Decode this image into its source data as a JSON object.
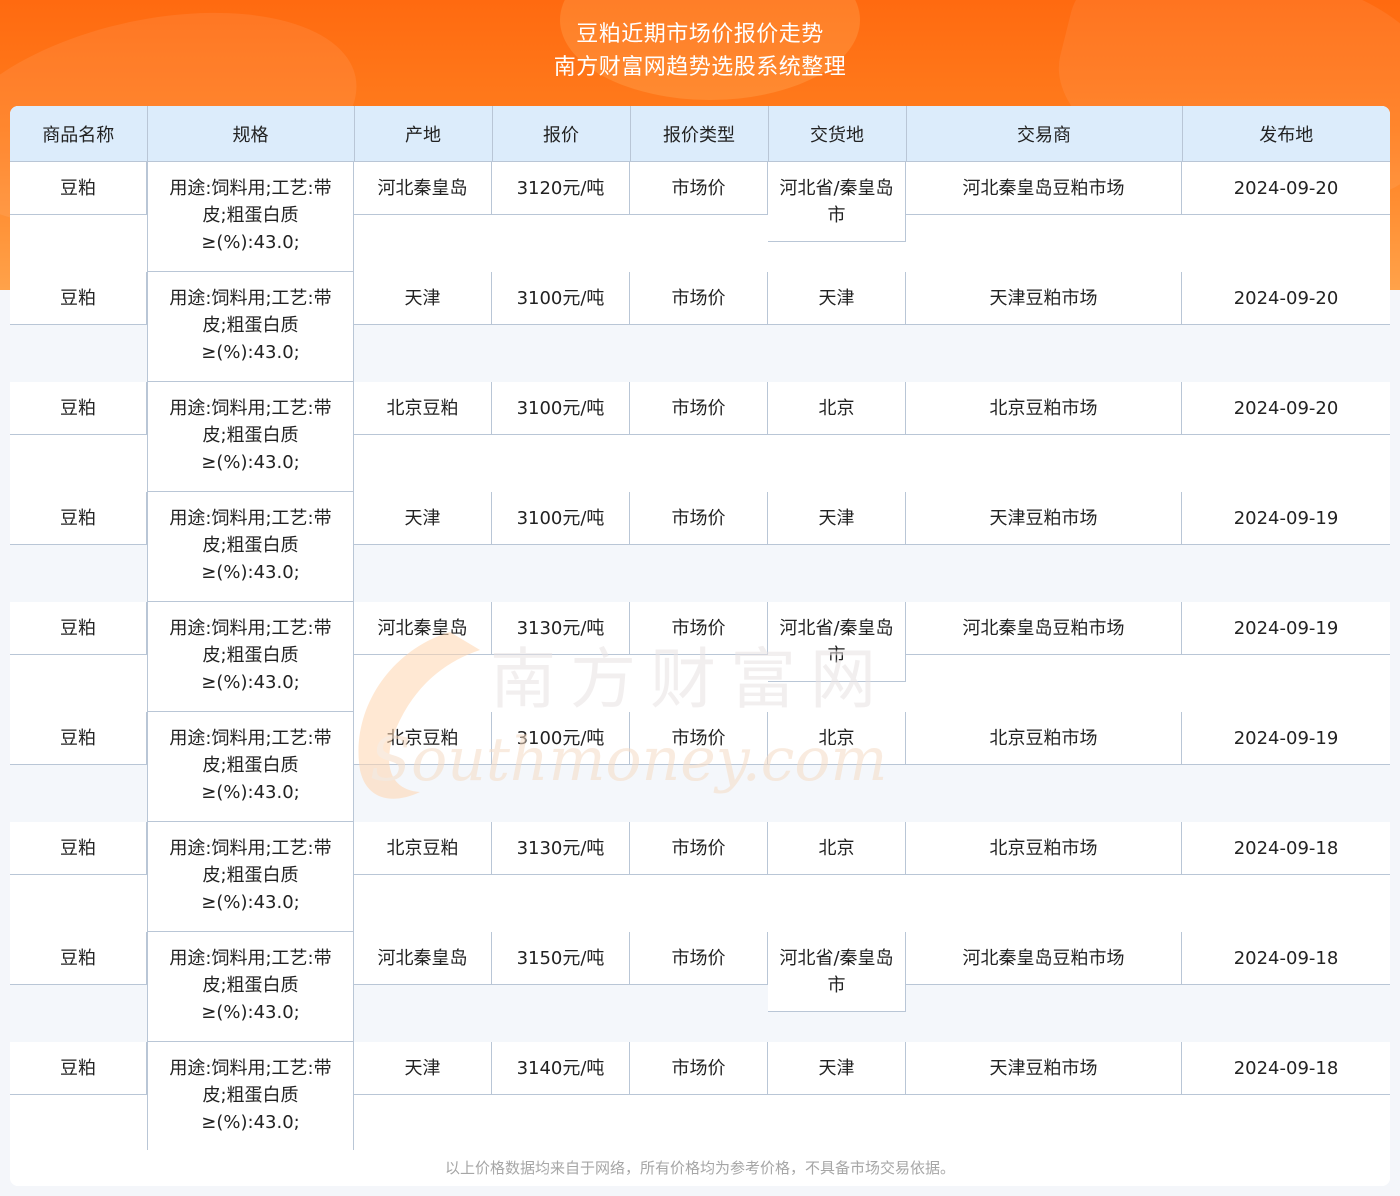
{
  "header": {
    "title": "豆粕近期市场价报价走势",
    "subtitle": "南方财富网趋势选股系统整理"
  },
  "table": {
    "columns": [
      "商品名称",
      "规格",
      "产地",
      "报价",
      "报价类型",
      "交货地",
      "交易商",
      "发布地"
    ],
    "rows": [
      [
        "豆粕",
        "用途:饲料用;工艺:带皮;粗蛋白质≥(%):43.0;",
        "河北秦皇岛",
        "3120元/吨",
        "市场价",
        "河北省/秦皇岛市",
        "河北秦皇岛豆粕市场",
        "2024-09-20"
      ],
      [
        "豆粕",
        "用途:饲料用;工艺:带皮;粗蛋白质≥(%):43.0;",
        "天津",
        "3100元/吨",
        "市场价",
        "天津",
        "天津豆粕市场",
        "2024-09-20"
      ],
      [
        "豆粕",
        "用途:饲料用;工艺:带皮;粗蛋白质≥(%):43.0;",
        "北京豆粕",
        "3100元/吨",
        "市场价",
        "北京",
        "北京豆粕市场",
        "2024-09-20"
      ],
      [
        "豆粕",
        "用途:饲料用;工艺:带皮;粗蛋白质≥(%):43.0;",
        "天津",
        "3100元/吨",
        "市场价",
        "天津",
        "天津豆粕市场",
        "2024-09-19"
      ],
      [
        "豆粕",
        "用途:饲料用;工艺:带皮;粗蛋白质≥(%):43.0;",
        "河北秦皇岛",
        "3130元/吨",
        "市场价",
        "河北省/秦皇岛市",
        "河北秦皇岛豆粕市场",
        "2024-09-19"
      ],
      [
        "豆粕",
        "用途:饲料用;工艺:带皮;粗蛋白质≥(%):43.0;",
        "北京豆粕",
        "3100元/吨",
        "市场价",
        "北京",
        "北京豆粕市场",
        "2024-09-19"
      ],
      [
        "豆粕",
        "用途:饲料用;工艺:带皮;粗蛋白质≥(%):43.0;",
        "北京豆粕",
        "3130元/吨",
        "市场价",
        "北京",
        "北京豆粕市场",
        "2024-09-18"
      ],
      [
        "豆粕",
        "用途:饲料用;工艺:带皮;粗蛋白质≥(%):43.0;",
        "河北秦皇岛",
        "3150元/吨",
        "市场价",
        "河北省/秦皇岛市",
        "河北秦皇岛豆粕市场",
        "2024-09-18"
      ],
      [
        "豆粕",
        "用途:饲料用;工艺:带皮;粗蛋白质≥(%):43.0;",
        "天津",
        "3140元/吨",
        "市场价",
        "天津",
        "天津豆粕市场",
        "2024-09-18"
      ]
    ]
  },
  "footer": {
    "note": "以上价格数据均来自于网络，所有价格均为参考价格，不具备市场交易依据。"
  },
  "watermark": {
    "logo_text": "南方财富网",
    "domain_text": "Southmoney.com"
  },
  "colors": {
    "banner": "#ff7d1e",
    "header_bg": "#dcecfb",
    "stripe_bg": "#f4f7fb",
    "border": "#b9c6d6",
    "footer_text": "#a6a6a6"
  }
}
